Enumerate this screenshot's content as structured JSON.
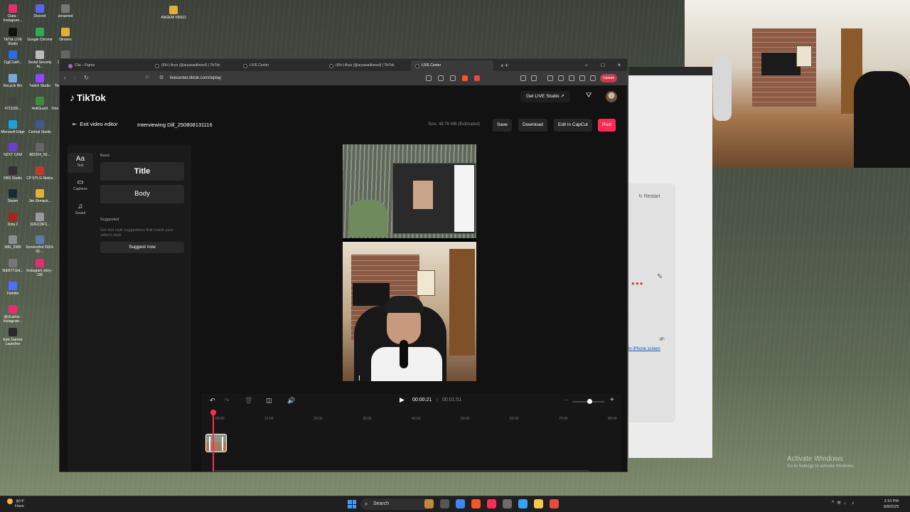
{
  "desktop": {
    "icons": [
      {
        "label": "Clara - Instagram...",
        "color": "#e1306c"
      },
      {
        "label": "TikTok LIVE Studio",
        "color": "#111111"
      },
      {
        "label": "CgjC1aW...",
        "color": "#2d6cdf"
      },
      {
        "label": "Recycle Bin",
        "color": "#7aa7d9"
      },
      {
        "label": "4721150...",
        "color": "#444444"
      },
      {
        "label": "Microsoft Edge",
        "color": "#1ba0d8"
      },
      {
        "label": "NZXT CAM",
        "color": "#6a3fd1"
      },
      {
        "label": "OBS Studio",
        "color": "#302e31"
      },
      {
        "label": "Steam",
        "color": "#1b2838"
      },
      {
        "label": "Dota 2",
        "color": "#a3281c"
      },
      {
        "label": "IMG_2980",
        "color": "#8c8c8c"
      },
      {
        "label": "5bb5771bd...",
        "color": "#777777"
      },
      {
        "label": "Fortnite",
        "color": "#4b6fff"
      },
      {
        "label": "@cfcarlos - Instagram...",
        "color": "#e1306c"
      },
      {
        "label": "Epic Games Launcher",
        "color": "#2a2a2a"
      },
      {
        "label": "Discord",
        "color": "#5865f2"
      },
      {
        "label": "Google Chrome",
        "color": "#34a853"
      },
      {
        "label": "Social Security Ar...",
        "color": "#bbbbbb"
      },
      {
        "label": "Twitch Studio",
        "color": "#9146ff"
      },
      {
        "label": "AntiGuard",
        "color": "#3d8b3d"
      },
      {
        "label": "Central Studio",
        "color": "#3d5a8b"
      },
      {
        "label": "882204_50...",
        "color": "#666666"
      },
      {
        "label": "CP 575 G Notice",
        "color": "#c0392b"
      },
      {
        "label": "Jim Shmack...",
        "color": "#e0b03a"
      },
      {
        "label": "32A1C8F3...",
        "color": "#999999"
      },
      {
        "label": "Screenshot 2024-05-...",
        "color": "#5a7da8"
      },
      {
        "label": "Instagram story - 195",
        "color": "#e1306c"
      },
      {
        "label": "unnamed",
        "color": "#777777"
      },
      {
        "label": "Dinners",
        "color": "#e0b03a"
      },
      {
        "label": "2eQ5en...",
        "color": "#666666"
      },
      {
        "label": "TikTok Videos",
        "color": "#e0b03a"
      },
      {
        "label": "One Direction F...",
        "color": "#e0b03a"
      },
      {
        "label": "ANGKM VIDEO",
        "color": "#e0b03a"
      }
    ]
  },
  "browser": {
    "tabs": [
      {
        "label": "Clia – Figma",
        "color": "#a259ff",
        "active": false
      },
      {
        "label": "(99+) Arya (@aryawaitbored) | TikTok",
        "color": "#111111",
        "active": false
      },
      {
        "label": "LIVE Center",
        "color": "#111111",
        "active": false
      },
      {
        "label": "(99+) Arya (@aryawaitbored) | TikTok",
        "color": "#111111",
        "active": false
      },
      {
        "label": "LIVE Center",
        "color": "#111111",
        "active": true
      }
    ],
    "new_tab": "+",
    "close_tab": "×",
    "minimize": "–",
    "maximize": "□",
    "close": "×",
    "url": "livecenter.tiktok.com/replay",
    "update_label": "Update"
  },
  "app": {
    "logo_text": "TikTok",
    "get_live_studio": "Get LIVE Studio ↗",
    "exit_label": "Exit video editor",
    "project_name": "Interviewing Dill_250808131116",
    "size_text": "Size: 48.76 MB (Estimated)",
    "save_label": "Save",
    "download_label": "Download",
    "edit_capcut_label": "Edit in CapCut",
    "post_label": "Post",
    "side_tabs": {
      "text_icon": "Aa",
      "text_label": "Text",
      "captions_label": "Captions",
      "sound_label": "Sound"
    },
    "basic_label": "Basic",
    "title_style": "Title",
    "body_style": "Body",
    "suggested_label": "Suggested",
    "suggested_hint": "Get text style suggestions that match your video's style",
    "suggest_now": "Suggest now"
  },
  "timeline": {
    "current_time": "00:00:21",
    "separator": "|",
    "total_time": "00:01:51",
    "ticks": [
      "00:00",
      "10:00",
      "20:00",
      "30:00",
      "40:00",
      "50:00",
      "60:00",
      "70:00",
      "80:00"
    ],
    "zoom_level": 0.55
  },
  "bg_window": {
    "restart_label": "Restart",
    "ip_label": "IP:",
    "iphone_link": "in iPhone screen"
  },
  "watermark": {
    "line1": "Activate Windows",
    "line2": "Go to Settings to activate Windows."
  },
  "taskbar": {
    "temperature": "80°F",
    "weather": "Haze",
    "search_placeholder": "Search",
    "time": "3:16 PM",
    "date": "8/8/2025",
    "apps": [
      {
        "name": "widgets",
        "color": "#c08a3a"
      },
      {
        "name": "task-view",
        "color": "#555555"
      },
      {
        "name": "chrome",
        "color": "#4285f4"
      },
      {
        "name": "brave",
        "color": "#fb542b"
      },
      {
        "name": "tiktok",
        "color": "#fe2c55"
      },
      {
        "name": "obs",
        "color": "#6d6d6d"
      },
      {
        "name": "notes",
        "color": "#3aa0ff"
      },
      {
        "name": "explorer",
        "color": "#f2c94c"
      },
      {
        "name": "screen-mirror",
        "color": "#e74c3c"
      }
    ]
  }
}
